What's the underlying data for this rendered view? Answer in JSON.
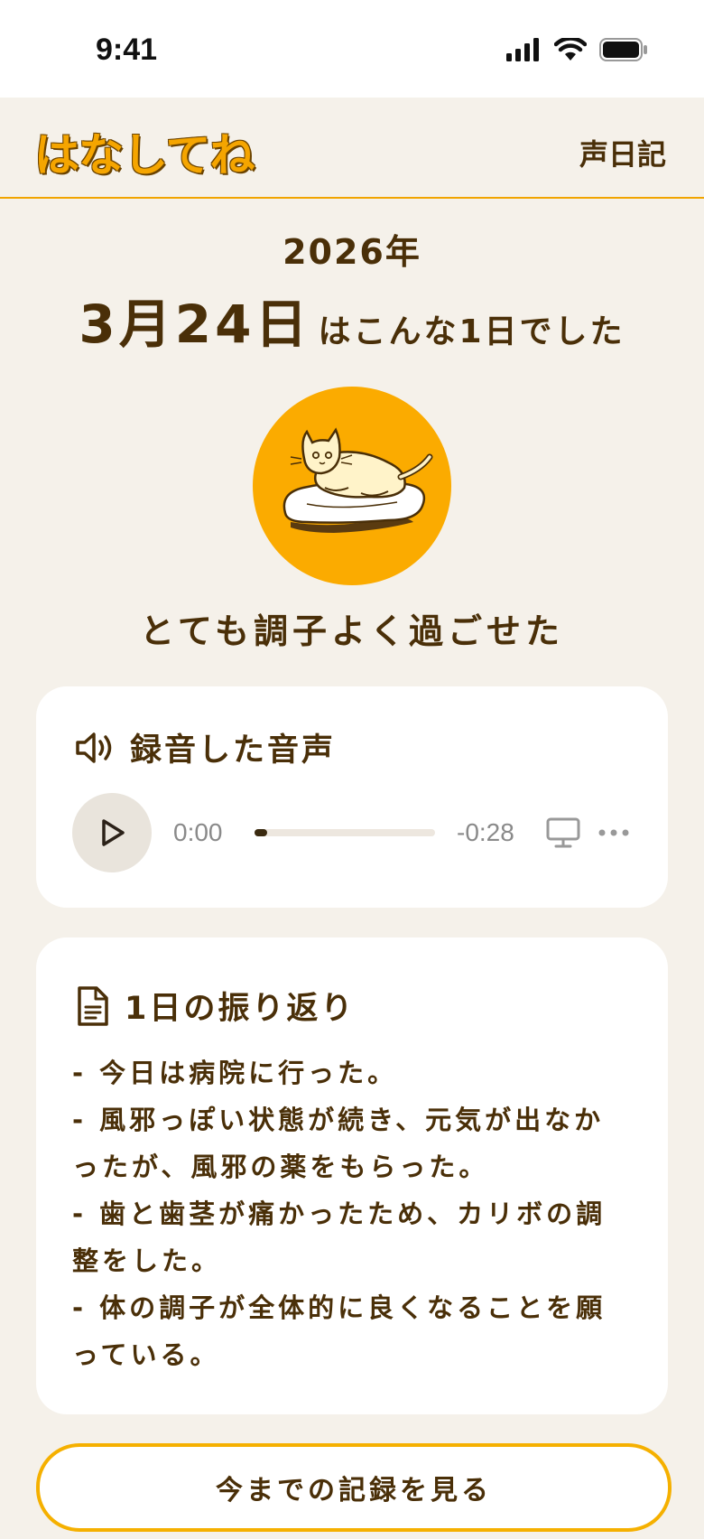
{
  "status_bar": {
    "time": "9:41"
  },
  "header": {
    "logo": "はなしてね",
    "right_label": "声日記"
  },
  "date": {
    "year": "2026年",
    "month_day": "3月24日",
    "suffix": "はこんな1日でした"
  },
  "mood": {
    "icon": "cat-lying-on-cushion-icon",
    "label": "とても調子よく過ごせた"
  },
  "audio": {
    "title": "録音した音声",
    "current_time": "0:00",
    "remaining_time": "-0:28",
    "progress": 0.03
  },
  "reflection": {
    "title": "1日の振り返り",
    "lines": [
      "- 今日は病院に行った。",
      "- 風邪っぽい状態が続き、元気が出なか",
      "ったが、風邪の薬をもらった。",
      "- 歯と歯茎が痛かったため、カリボの調",
      "整をした。",
      "- 体の調子が全体的に良くなることを願",
      "っている。"
    ]
  },
  "history_button": {
    "label": "今までの記録を見る"
  },
  "colors": {
    "accent": "#f5a500",
    "background": "#f5f1ea",
    "text": "#4a2f08",
    "card": "#ffffff"
  }
}
